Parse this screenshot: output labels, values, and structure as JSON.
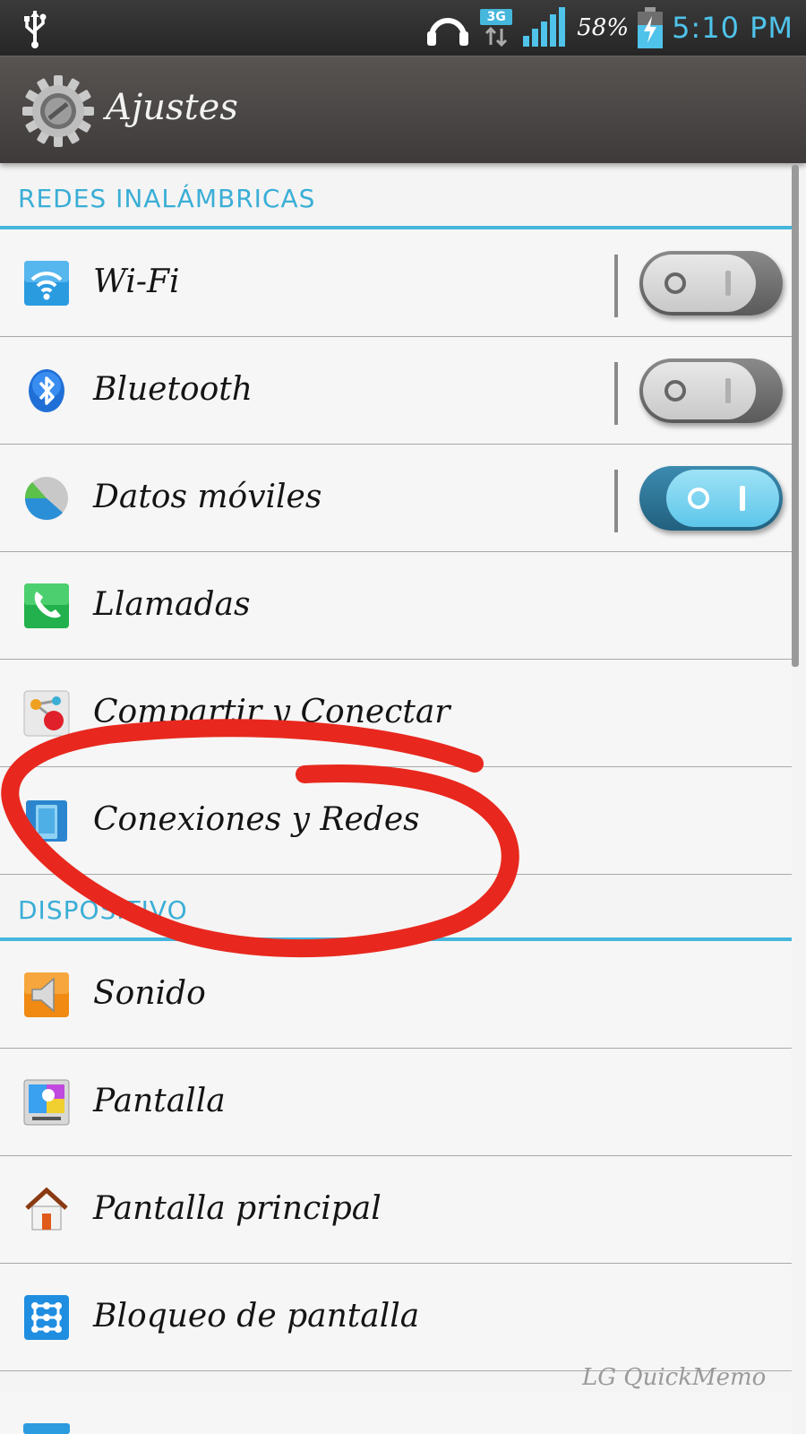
{
  "status_bar": {
    "battery_percent": "58%",
    "time": "5:10 PM",
    "network_type": "3G",
    "icons": [
      "usb-icon",
      "headset-icon",
      "3g-data-icon",
      "signal-icon",
      "battery-charging-icon"
    ]
  },
  "title_bar": {
    "title": "Ajustes",
    "icon": "settings-gear-icon"
  },
  "sections": {
    "wireless": {
      "header": "REDES INALÁMBRICAS",
      "items": [
        {
          "label": "Wi-Fi",
          "icon": "wifi-icon",
          "toggle": "off"
        },
        {
          "label": "Bluetooth",
          "icon": "bluetooth-icon",
          "toggle": "off"
        },
        {
          "label": "Datos móviles",
          "icon": "data-usage-icon",
          "toggle": "on"
        },
        {
          "label": "Llamadas",
          "icon": "phone-icon"
        },
        {
          "label": "Compartir y Conectar",
          "icon": "share-connect-icon"
        },
        {
          "label": "Conexiones y Redes",
          "icon": "connections-networks-icon"
        }
      ]
    },
    "device": {
      "header": "DISPOSITIVO",
      "items": [
        {
          "label": "Sonido",
          "icon": "speaker-icon"
        },
        {
          "label": "Pantalla",
          "icon": "display-icon"
        },
        {
          "label": "Pantalla principal",
          "icon": "home-icon"
        },
        {
          "label": "Bloqueo de pantalla",
          "icon": "lock-pattern-icon"
        }
      ]
    }
  },
  "watermark": "LG QuickMemo",
  "colors": {
    "accent": "#45b6dc",
    "annotation": "#e8281e",
    "toggle_on": "#5dc6ea"
  }
}
